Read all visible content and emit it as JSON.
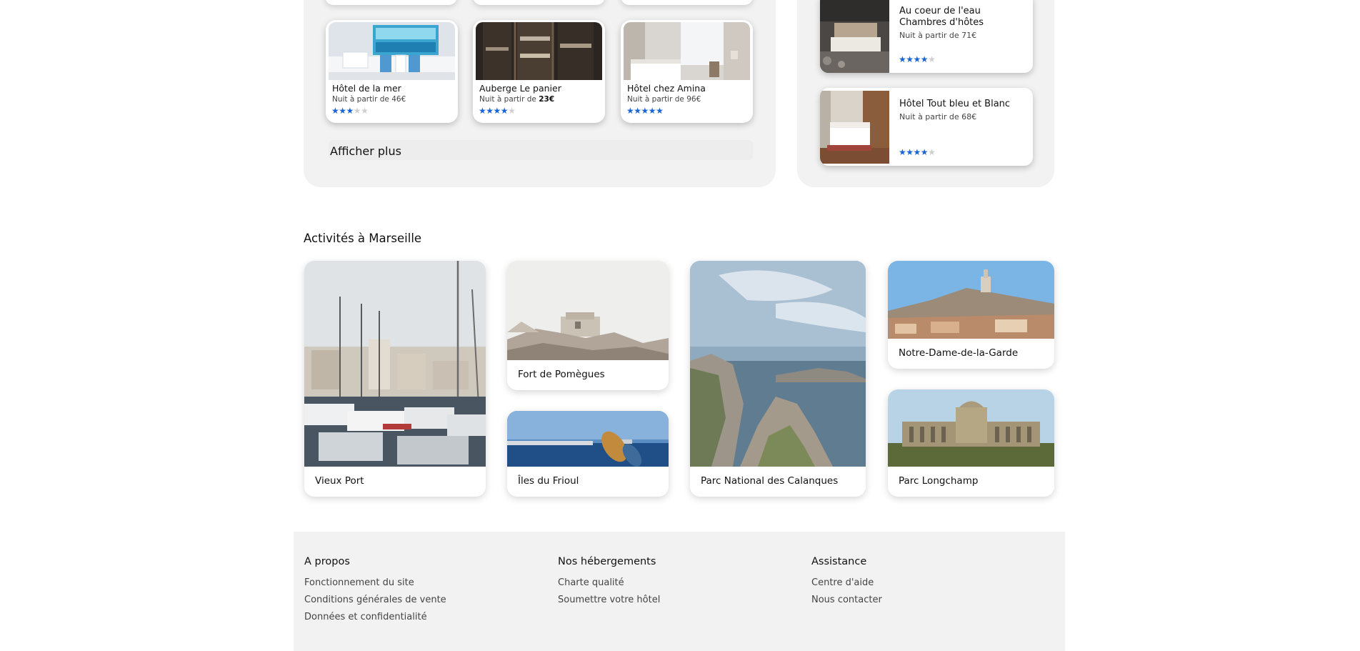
{
  "hotels_grid": [
    {
      "name": "Hôtel de la mer",
      "price_prefix": "Nuit à partir de ",
      "price": "46€",
      "price_bold": false,
      "rating": 3,
      "max_rating": 5
    },
    {
      "name": "Auberge Le panier",
      "price_prefix": "Nuit à partir de ",
      "price": "23€",
      "price_bold": true,
      "rating": 4,
      "max_rating": 5
    },
    {
      "name": "Hôtel chez Amina",
      "price_prefix": "Nuit à partir de ",
      "price": "96€",
      "price_bold": false,
      "rating": 5,
      "max_rating": 5
    }
  ],
  "show_more_label": "Afficher plus",
  "side_hotels": [
    {
      "name_line1": "Au coeur de l'eau",
      "name_line2": "Chambres d'hôtes",
      "price_label": "Nuit à partir de 71€",
      "rating": 4,
      "max_rating": 5
    },
    {
      "name_line1": "Hôtel Tout bleu et Blanc",
      "name_line2": "",
      "price_label": "Nuit à partir de 68€",
      "rating": 4,
      "max_rating": 5
    }
  ],
  "activities": {
    "title": "Activités à Marseille",
    "items": {
      "vieux_port": "Vieux Port",
      "fort": "Fort de Pomègues",
      "frioul": "Îles du Frioul",
      "calanques": "Parc National des Calanques",
      "notre_dame": "Notre-Dame-de-la-Garde",
      "longchamp": "Parc Longchamp"
    }
  },
  "footer": {
    "about": {
      "title": "A propos",
      "links": [
        "Fonctionnement du site",
        "Conditions générales de vente",
        "Données et confidentialité"
      ]
    },
    "accommodations": {
      "title": "Nos hébergements",
      "links": [
        "Charte qualité",
        "Soumettre votre hôtel"
      ]
    },
    "assistance": {
      "title": "Assistance",
      "links": [
        "Centre d'aide",
        "Nous contacter"
      ]
    }
  },
  "colors": {
    "star_on": "#1b64d6",
    "star_off": "#cfcfcf",
    "panel_bg": "#f2f2f2"
  }
}
